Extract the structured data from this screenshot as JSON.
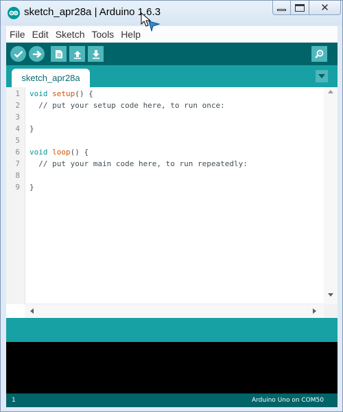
{
  "window": {
    "title": "sketch_apr28a | Arduino 1.6.3",
    "controls": {
      "minimize_icon": "minimize-icon",
      "maximize_icon": "maximize-icon",
      "close_icon": "close-icon"
    }
  },
  "menu": {
    "items": [
      {
        "label": "File"
      },
      {
        "label": "Edit"
      },
      {
        "label": "Sketch"
      },
      {
        "label": "Tools"
      },
      {
        "label": "Help"
      }
    ]
  },
  "toolbar": {
    "buttons": [
      "verify-icon",
      "upload-icon",
      "new-icon",
      "open-icon",
      "save-icon"
    ],
    "serial_monitor_icon": "magnifier-icon"
  },
  "tabs": [
    {
      "label": "sketch_apr28a",
      "active": true
    }
  ],
  "editor": {
    "line_numbers": [
      "1",
      "2",
      "3",
      "4",
      "5",
      "6",
      "7",
      "8",
      "9"
    ],
    "lines": [
      {
        "type": "void",
        "fn": "setup",
        "rest": "() {"
      },
      {
        "comment": "  // put your setup code here, to run once:"
      },
      {
        "text": ""
      },
      {
        "text": "}"
      },
      {
        "text": ""
      },
      {
        "type": "void",
        "fn": "loop",
        "rest": "() {"
      },
      {
        "comment": "  // put your main code here, to run repeatedly:"
      },
      {
        "text": ""
      },
      {
        "text": "}"
      }
    ]
  },
  "status": {
    "line": "1",
    "board": "Arduino Uno on COM50"
  },
  "colors": {
    "toolbar": "#006468",
    "tabbar": "#17a1a5",
    "button": "#4db7bb",
    "keyword": "#00979c",
    "function": "#d35400"
  }
}
